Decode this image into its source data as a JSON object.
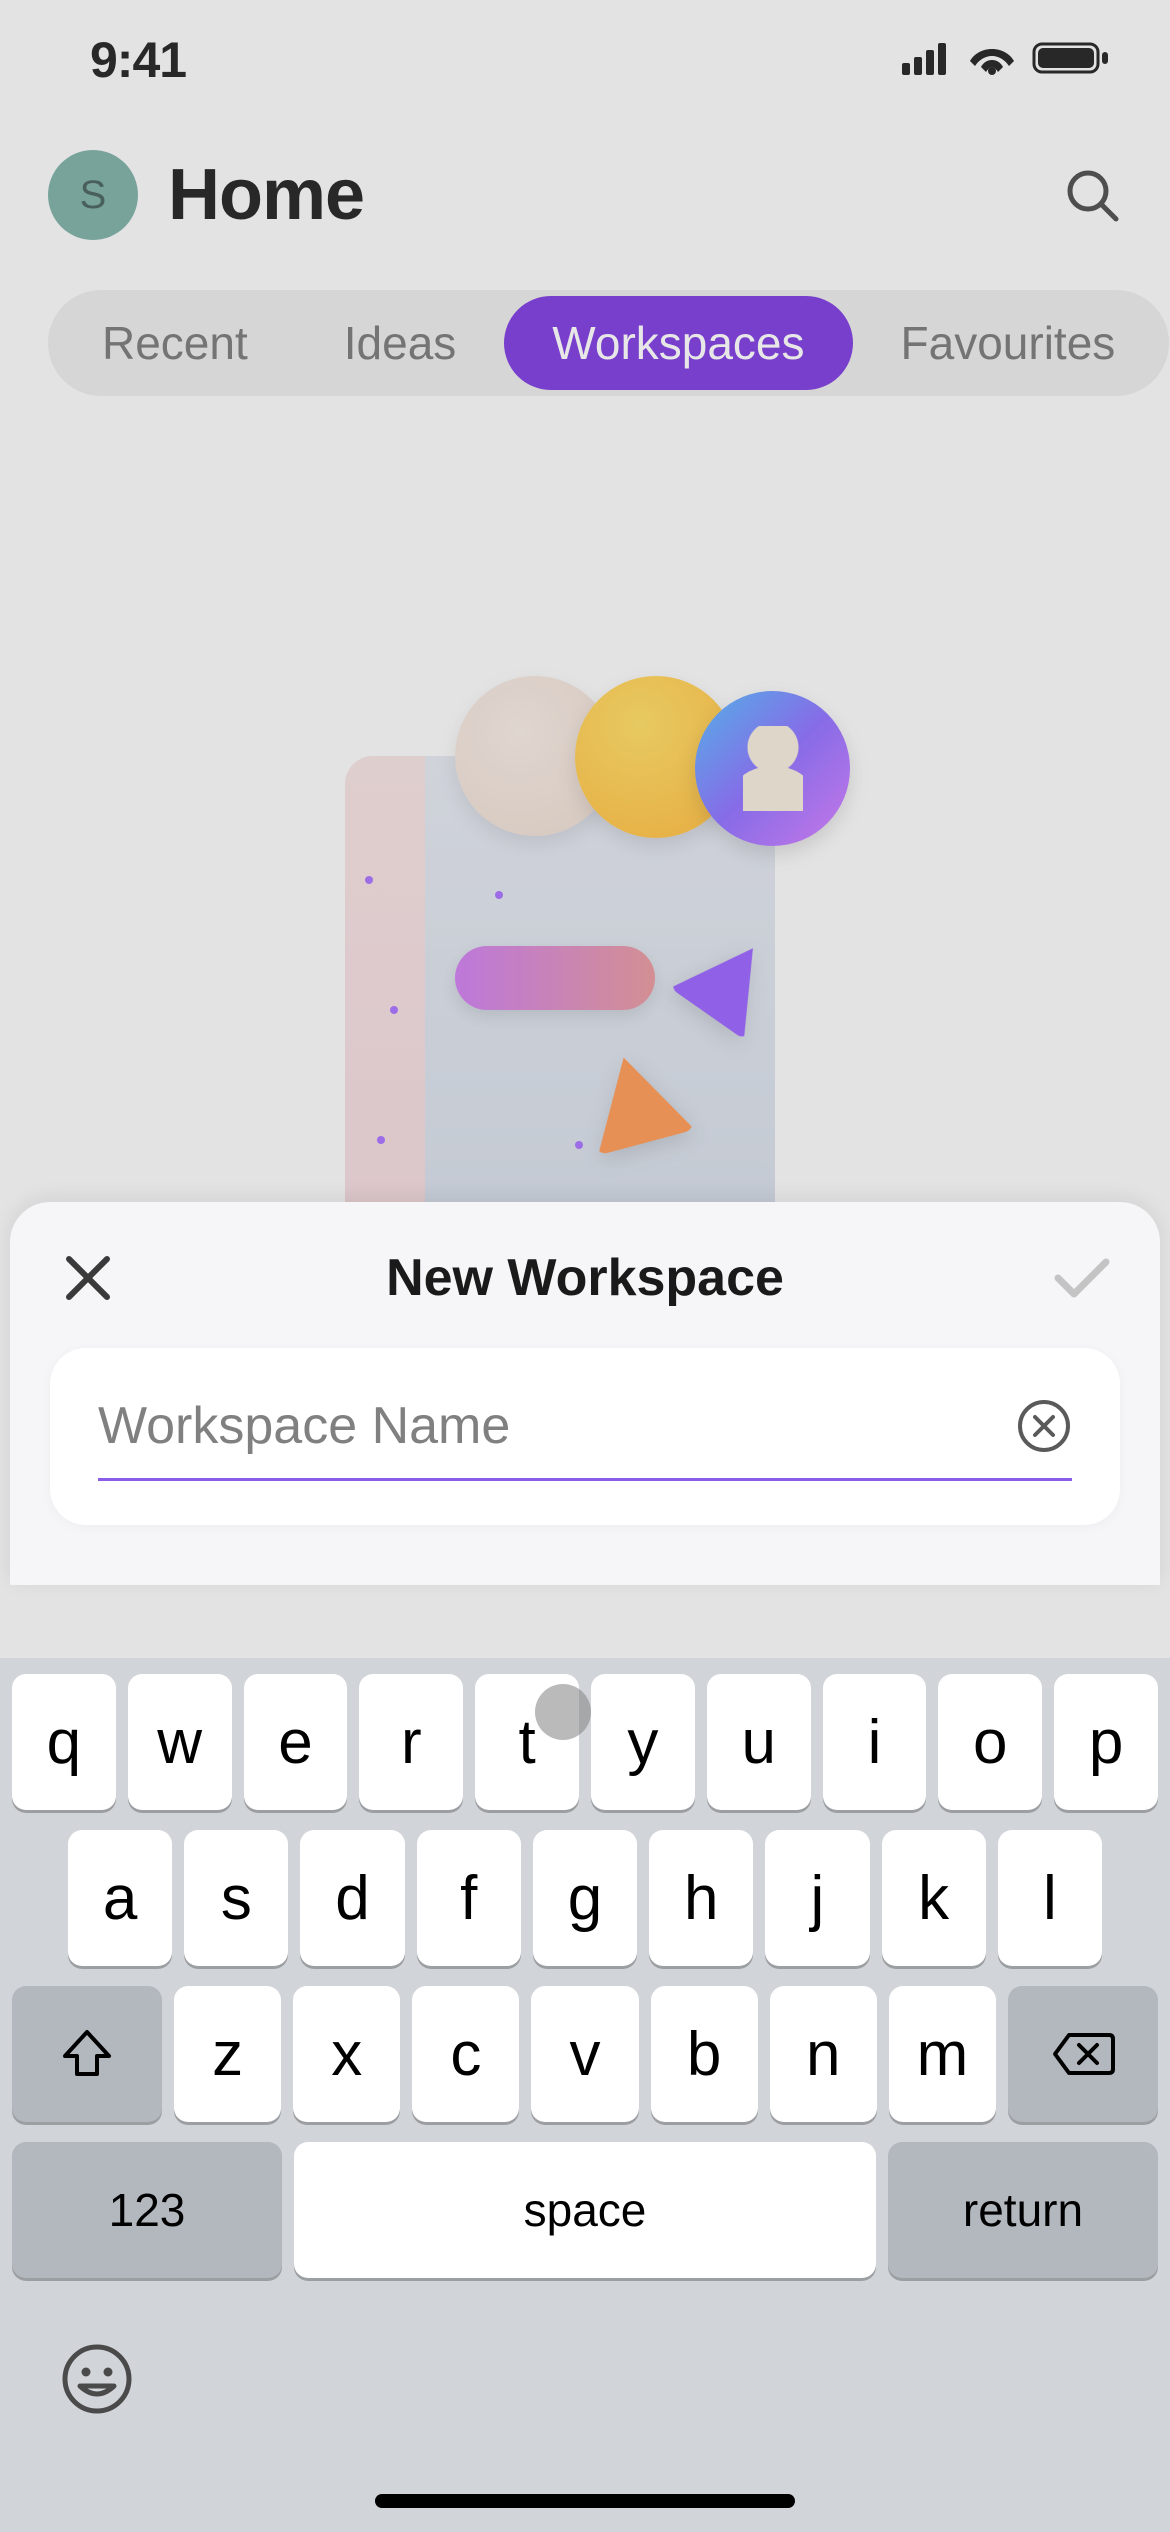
{
  "status": {
    "time": "9:41"
  },
  "header": {
    "avatar_initial": "S",
    "title": "Home"
  },
  "tabs": {
    "items": [
      {
        "label": "Recent",
        "active": false
      },
      {
        "label": "Ideas",
        "active": false
      },
      {
        "label": "Workspaces",
        "active": true
      },
      {
        "label": "Favourites",
        "active": false
      }
    ]
  },
  "sheet": {
    "title": "New Workspace",
    "input_value": "",
    "input_placeholder": "Workspace Name"
  },
  "keyboard": {
    "row1": [
      "q",
      "w",
      "e",
      "r",
      "t",
      "y",
      "u",
      "i",
      "o",
      "p"
    ],
    "row2": [
      "a",
      "s",
      "d",
      "f",
      "g",
      "h",
      "j",
      "k",
      "l"
    ],
    "row3": [
      "z",
      "x",
      "c",
      "v",
      "b",
      "n",
      "m"
    ],
    "numbers_label": "123",
    "space_label": "space",
    "return_label": "return"
  }
}
